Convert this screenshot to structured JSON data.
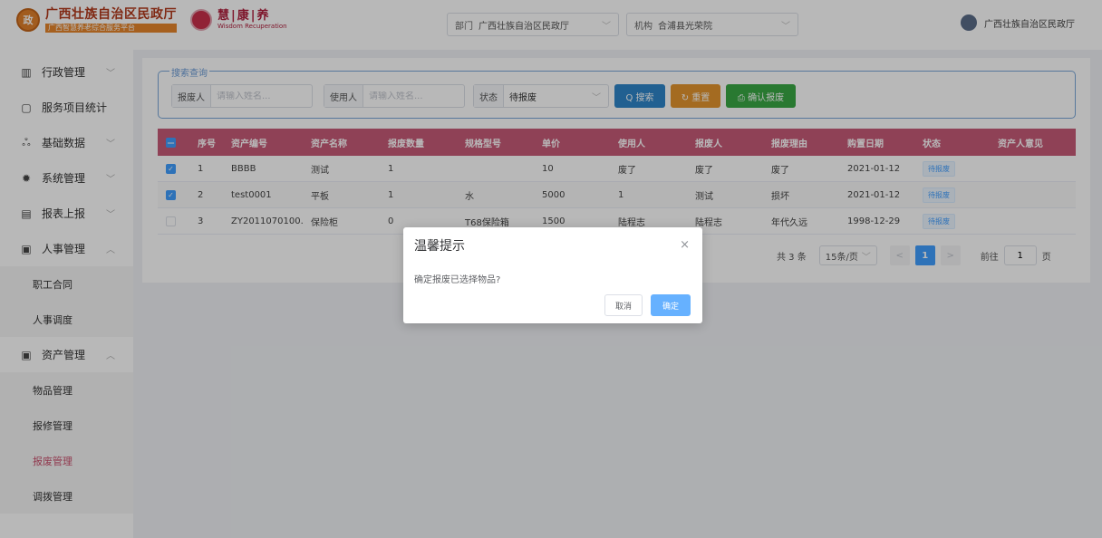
{
  "header": {
    "logo1": {
      "emblem": "政",
      "title": "广西壮族自治区民政厅",
      "subtitle": "广西智慧养老综合服务平台"
    },
    "logo2": {
      "title": "慧|康|养",
      "subtitle": "Wisdom Recuperation"
    },
    "dept": {
      "label": "部门",
      "value": "广西壮族自治区民政厅"
    },
    "org": {
      "label": "机构",
      "value": "合浦县光荣院"
    },
    "user": {
      "name": "广西壮族自治区民政厅"
    }
  },
  "sidebar": {
    "items": [
      {
        "label": "行政管理",
        "icon": "building-icon",
        "glyph": "▥",
        "chevron": "﹀"
      },
      {
        "label": "服务项目统计",
        "icon": "chat-icon",
        "glyph": "▢",
        "chevron": ""
      },
      {
        "label": "基础数据",
        "icon": "users-icon",
        "glyph": "ஃ",
        "chevron": "﹀"
      },
      {
        "label": "系统管理",
        "icon": "gear-icon",
        "glyph": "✹",
        "chevron": "﹀"
      },
      {
        "label": "报表上报",
        "icon": "report-icon",
        "glyph": "▤",
        "chevron": "﹀"
      },
      {
        "label": "人事管理",
        "icon": "person-card-icon",
        "glyph": "▣",
        "chevron": "︿"
      }
    ],
    "hr_sub": [
      "职工合同",
      "人事调度"
    ],
    "asset": {
      "label": "资产管理",
      "icon": "asset-icon",
      "glyph": "▣",
      "chevron": "︿"
    },
    "asset_sub": [
      "物品管理",
      "报修管理",
      "报废管理",
      "调拨管理"
    ],
    "active_sub": "报废管理"
  },
  "search": {
    "legend": "搜索查询",
    "scrapper": {
      "label": "报废人",
      "placeholder": "请输入姓名..."
    },
    "user": {
      "label": "使用人",
      "placeholder": "请输入姓名..."
    },
    "status": {
      "label": "状态",
      "value": "待报废"
    },
    "buttons": {
      "search": "Q 搜索",
      "reset": "↻ 重置",
      "confirm": "⎙ 确认报废"
    }
  },
  "table": {
    "columns": [
      "序号",
      "资产编号",
      "资产名称",
      "报废数量",
      "规格型号",
      "单价",
      "使用人",
      "报废人",
      "报废理由",
      "购置日期",
      "状态",
      "资产人意见"
    ],
    "rows": [
      {
        "checked": true,
        "cells": [
          "1",
          "BBBB",
          "测试",
          "1",
          "",
          "10",
          "废了",
          "废了",
          "废了",
          "2021-01-12",
          "待报废",
          ""
        ]
      },
      {
        "checked": true,
        "cells": [
          "2",
          "test0001",
          "平板",
          "1",
          "水",
          "5000",
          "1",
          "测试",
          "损坏",
          "2021-01-12",
          "待报废",
          ""
        ]
      },
      {
        "checked": false,
        "cells": [
          "3",
          "ZY2011070100...",
          "保险柜",
          "0",
          "T68保险箱",
          "1500",
          "陆程志",
          "陆程志",
          "年代久远",
          "1998-12-29",
          "待报废",
          ""
        ]
      }
    ]
  },
  "pager": {
    "total": "共 3 条",
    "size": "15条/页",
    "prev": "<",
    "page": "1",
    "next": ">",
    "goto": "前往",
    "goto_value": "1",
    "page_unit": "页"
  },
  "modal": {
    "title": "温馨提示",
    "message": "确定报废已选择物品?",
    "cancel": "取消",
    "ok": "确定",
    "close": "×"
  },
  "colors": {
    "table_header": "#c65a78",
    "primary": "#409eff",
    "search_btn": "#2f86c9",
    "reset_btn": "#e4952e",
    "confirm_btn": "#39a845",
    "active_menu": "#c94f6d"
  }
}
